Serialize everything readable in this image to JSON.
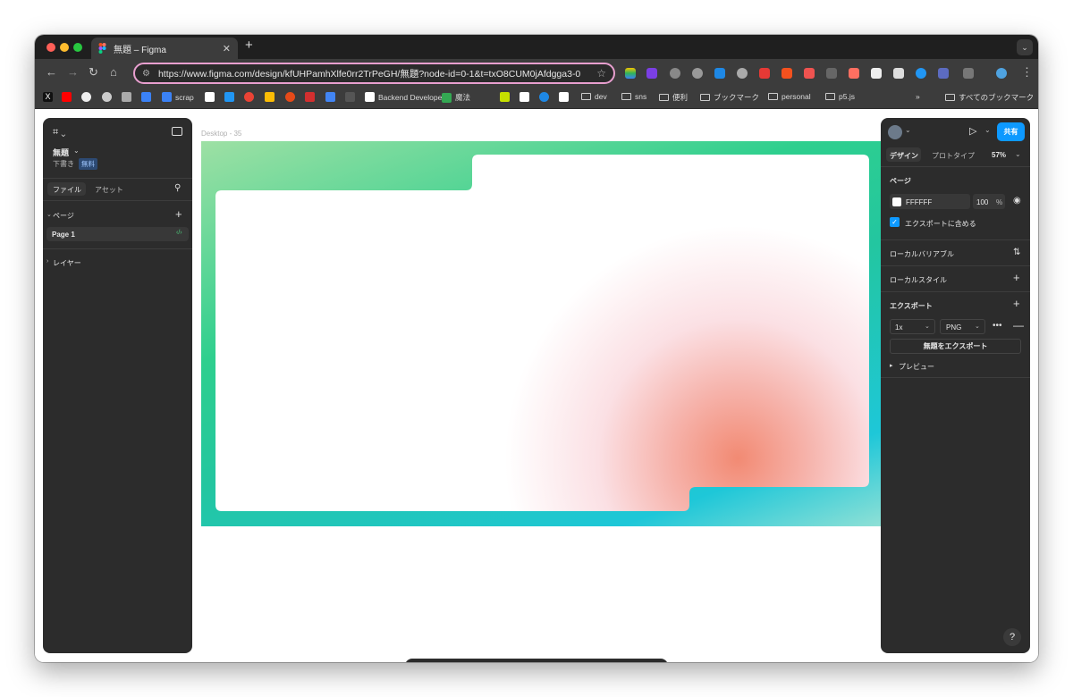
{
  "browser": {
    "tab_title": "無題 – Figma",
    "url": "https://www.figma.com/design/kfUHPamhXlfe0rr2TrPeGH/無題?node-id=0-1&t=txO8CUM0jAfdgga3-0",
    "bookmarks": [
      "scrap",
      "Backend Develope...",
      "魔法",
      "dev",
      "sns",
      "便利",
      "ブックマーク",
      "personal",
      "p5.js"
    ],
    "all_bookmarks": "すべてのブックマーク"
  },
  "left_panel": {
    "file_name": "無題",
    "file_status": "下書き",
    "plan_badge": "無料",
    "tab_file": "ファイル",
    "tab_assets": "アセット",
    "pages_label": "ページ",
    "page_item": "Page 1",
    "layers_label": "レイヤー"
  },
  "right_panel": {
    "share": "共有",
    "tab_design": "デザイン",
    "tab_prototype": "プロトタイプ",
    "zoom": "57%",
    "page_section": "ページ",
    "bg_color": "FFFFFF",
    "bg_opacity": "100",
    "percent": "%",
    "include_export": "エクスポートに含める",
    "local_variables": "ローカルバリアブル",
    "local_styles": "ローカルスタイル",
    "export_section": "エクスポート",
    "export_scale": "1x",
    "export_format": "PNG",
    "export_button": "無題をエクスポート",
    "preview": "プレビュー"
  },
  "canvas": {
    "frame_label": "Desktop - 35"
  },
  "colors": {
    "accent": "#0d99ff",
    "panel": "#2c2c2c"
  }
}
